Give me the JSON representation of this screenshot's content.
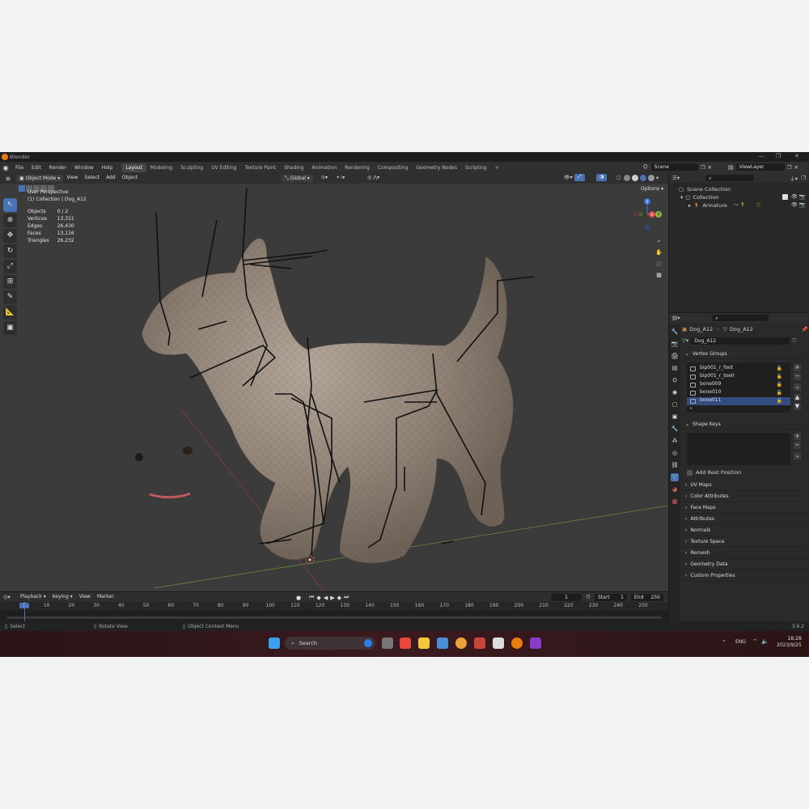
{
  "window": {
    "title": "Blender"
  },
  "menu": [
    "File",
    "Edit",
    "Render",
    "Window",
    "Help"
  ],
  "workspaces": [
    {
      "label": "Layout",
      "active": true
    },
    {
      "label": "Modeling"
    },
    {
      "label": "Sculpting"
    },
    {
      "label": "UV Editing"
    },
    {
      "label": "Texture Paint"
    },
    {
      "label": "Shading"
    },
    {
      "label": "Animation"
    },
    {
      "label": "Rendering"
    },
    {
      "label": "Compositing"
    },
    {
      "label": "Geometry Nodes"
    },
    {
      "label": "Scripting"
    }
  ],
  "add_workspace": "+",
  "scene": {
    "name": "Scene",
    "viewlayer": "ViewLayer"
  },
  "viewport_header": {
    "mode": "Object Mode",
    "menus": [
      "View",
      "Select",
      "Add",
      "Object"
    ],
    "transform": "Global",
    "options": "Options"
  },
  "overlay": {
    "perspective": "User Perspective",
    "collection": "(1) Collection | Dog_A12",
    "stats": [
      {
        "label": "Objects",
        "value": "0 / 2"
      },
      {
        "label": "Vertices",
        "value": "13,311"
      },
      {
        "label": "Edges",
        "value": "26,430"
      },
      {
        "label": "Faces",
        "value": "13,116"
      },
      {
        "label": "Triangles",
        "value": "26,232"
      }
    ]
  },
  "gizmo": {
    "z": "Z",
    "y": "Y",
    "x": "X"
  },
  "outliner": {
    "scene_collection": "Scene Collection",
    "collection": "Collection",
    "armature": "Armature"
  },
  "properties": {
    "object": "Dog_A12",
    "mesh": "Dog_A12",
    "data_name": "Dog_A12",
    "vertex_groups_title": "Vertex Groups",
    "vertex_groups": [
      {
        "name": "bip001_r_foot"
      },
      {
        "name": "bip001_r_toe0"
      },
      {
        "name": "bone009"
      },
      {
        "name": "bone010"
      },
      {
        "name": "bone011",
        "selected": true
      }
    ],
    "shape_keys_title": "Shape Keys",
    "add_rest_position": "Add Rest Position",
    "collapsed_panels": [
      "UV Maps",
      "Color Attributes",
      "Face Maps",
      "Attributes",
      "Normals",
      "Texture Space",
      "Remesh",
      "Geometry Data",
      "Custom Properties"
    ]
  },
  "timeline": {
    "menus": [
      "Playback",
      "Keying",
      "View",
      "Marker"
    ],
    "current_frame": "1",
    "start_label": "Start",
    "start": "1",
    "end_label": "End",
    "end": "250",
    "ticks": [
      "1",
      "10",
      "20",
      "30",
      "40",
      "50",
      "60",
      "70",
      "80",
      "90",
      "100",
      "110",
      "120",
      "130",
      "140",
      "150",
      "160",
      "170",
      "180",
      "190",
      "200",
      "210",
      "220",
      "230",
      "240",
      "250"
    ]
  },
  "statusbar": {
    "select": "Select",
    "rotate": "Rotate View",
    "context": "Object Context Menu",
    "version": "3.6.2"
  },
  "taskbar": {
    "search": "Search",
    "lang": "ENG",
    "time": "18:28",
    "date": "2023/9/25"
  }
}
